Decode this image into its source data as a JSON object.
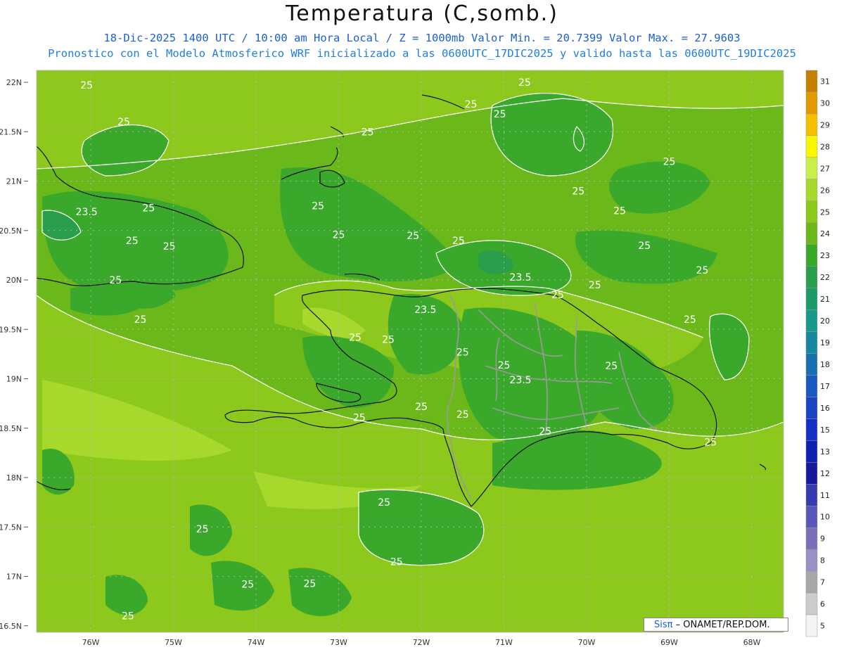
{
  "header": {
    "title": "Temperatura (C,somb.)",
    "line1": "18-Dic-2025 1400 UTC / 10:00 am Hora Local / Z = 1000mb  Valor Min. = 20.7399  Valor Max. = 27.9603",
    "line2": "Pronostico con el Modelo Atmosferico WRF inicializado a las 0600UTC_17DIC2025 y valido hasta las  0600UTC_19DIC2025"
  },
  "map": {
    "lat_labels": [
      "22N",
      "21.5N",
      "21N",
      "20.5N",
      "20N",
      "19.5N",
      "19N",
      "18.5N",
      "18N",
      "17.5N",
      "17N",
      "16.5N"
    ],
    "lon_labels": [
      "76W",
      "75W",
      "74W",
      "73W",
      "72W",
      "71W",
      "70W",
      "69W",
      "68W"
    ],
    "contour_labels": [
      {
        "text": "25",
        "lon": -76.05,
        "lat": 21.97
      },
      {
        "text": "25",
        "lon": -75.6,
        "lat": 21.6
      },
      {
        "text": "23.5",
        "lon": -76.05,
        "lat": 20.69
      },
      {
        "text": "25",
        "lon": -75.3,
        "lat": 20.73
      },
      {
        "text": "25",
        "lon": -75.05,
        "lat": 20.34
      },
      {
        "text": "25",
        "lon": -75.5,
        "lat": 20.4
      },
      {
        "text": "25",
        "lon": -75.7,
        "lat": 20.0
      },
      {
        "text": "25",
        "lon": -75.4,
        "lat": 19.6
      },
      {
        "text": "25",
        "lon": -73.25,
        "lat": 20.75
      },
      {
        "text": "25",
        "lon": -73.0,
        "lat": 20.46
      },
      {
        "text": "25",
        "lon": -72.1,
        "lat": 20.45
      },
      {
        "text": "25",
        "lon": -71.55,
        "lat": 20.4
      },
      {
        "text": "25",
        "lon": -71.4,
        "lat": 21.78
      },
      {
        "text": "25",
        "lon": -70.75,
        "lat": 22.0
      },
      {
        "text": "25",
        "lon": -71.05,
        "lat": 21.68
      },
      {
        "text": "25",
        "lon": -72.65,
        "lat": 21.5
      },
      {
        "text": "25",
        "lon": -70.1,
        "lat": 20.9
      },
      {
        "text": "25",
        "lon": -69.6,
        "lat": 20.7
      },
      {
        "text": "25",
        "lon": -69.0,
        "lat": 21.2
      },
      {
        "text": "25",
        "lon": -69.3,
        "lat": 20.35
      },
      {
        "text": "25",
        "lon": -68.6,
        "lat": 20.1
      },
      {
        "text": "25",
        "lon": -69.9,
        "lat": 19.95
      },
      {
        "text": "25",
        "lon": -68.75,
        "lat": 19.6
      },
      {
        "text": "23.5",
        "lon": -71.95,
        "lat": 19.7
      },
      {
        "text": "23.5",
        "lon": -70.8,
        "lat": 20.03
      },
      {
        "text": "25",
        "lon": -70.35,
        "lat": 19.85
      },
      {
        "text": "25",
        "lon": -72.8,
        "lat": 19.42
      },
      {
        "text": "25",
        "lon": -72.4,
        "lat": 19.4
      },
      {
        "text": "25",
        "lon": -71.5,
        "lat": 19.27
      },
      {
        "text": "25",
        "lon": -71.0,
        "lat": 19.14
      },
      {
        "text": "23.5",
        "lon": -70.8,
        "lat": 18.99
      },
      {
        "text": "25",
        "lon": -69.7,
        "lat": 19.13
      },
      {
        "text": "25",
        "lon": -72.0,
        "lat": 18.72
      },
      {
        "text": "25",
        "lon": -71.5,
        "lat": 18.64
      },
      {
        "text": "25",
        "lon": -72.75,
        "lat": 18.61
      },
      {
        "text": "25",
        "lon": -70.5,
        "lat": 18.47
      },
      {
        "text": "25",
        "lon": -68.5,
        "lat": 18.36
      },
      {
        "text": "25",
        "lon": -72.45,
        "lat": 17.75
      },
      {
        "text": "25",
        "lon": -72.3,
        "lat": 17.15
      },
      {
        "text": "25",
        "lon": -74.65,
        "lat": 17.48
      },
      {
        "text": "25",
        "lon": -74.1,
        "lat": 16.92
      },
      {
        "text": "25",
        "lon": -73.35,
        "lat": 16.93
      },
      {
        "text": "25",
        "lon": -75.55,
        "lat": 16.6
      }
    ]
  },
  "colorbar": {
    "labels": [
      "31",
      "30",
      "29",
      "28",
      "27",
      "26",
      "25",
      "24",
      "23",
      "22",
      "21",
      "20",
      "19",
      "18",
      "17",
      "16",
      "15",
      "13",
      "12",
      "11",
      "10",
      "9",
      "8",
      "7",
      "6",
      "5"
    ],
    "colors": [
      "#c47f00",
      "#e09a00",
      "#f5bf00",
      "#f7f700",
      "#c8f04a",
      "#a6d92c",
      "#8dc81c",
      "#6ab81a",
      "#3aa82a",
      "#2a9e4a",
      "#1d9a6a",
      "#179a8a",
      "#1788a0",
      "#1870b0",
      "#1a5ac0",
      "#1a44c4",
      "#1530c4",
      "#1020b0",
      "#181898",
      "#3a3ab0",
      "#5858b8",
      "#7a70b8",
      "#9a90c8",
      "#a8a8a8",
      "#cccccc",
      "#f4f4f4"
    ]
  },
  "credit": {
    "sis": "Sisπ",
    "org": "– ONAMET/REP.DOM."
  }
}
